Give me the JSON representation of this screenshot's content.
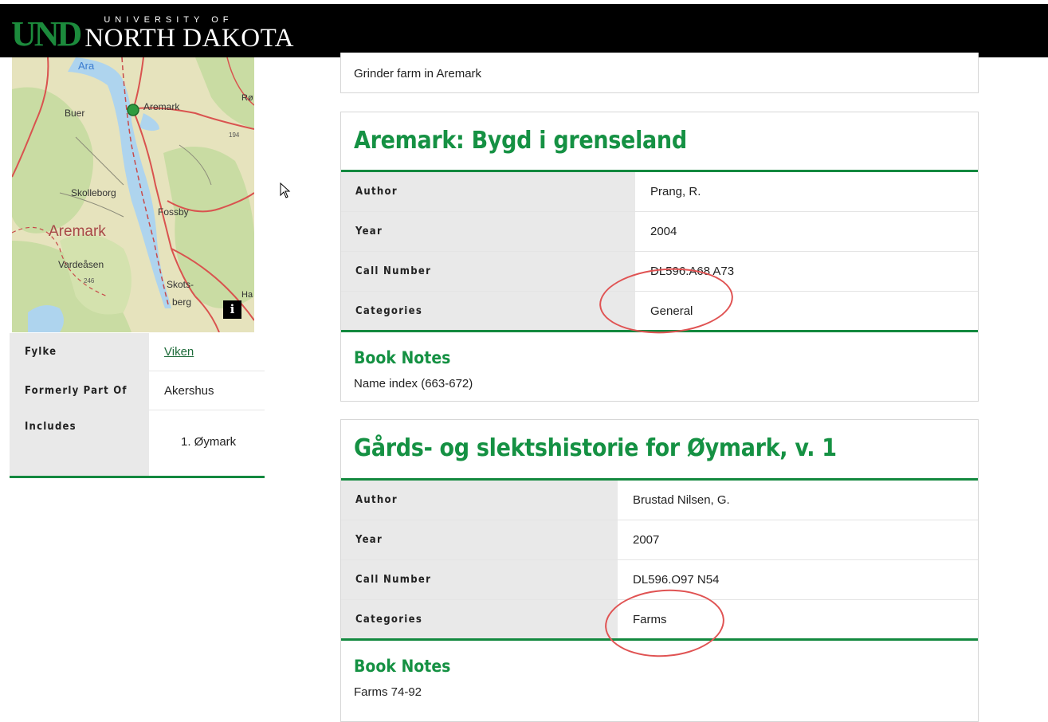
{
  "header": {
    "logo_mark": "UND",
    "university_of": "UNIVERSITY OF",
    "university_name": "NORTH DAKOTA"
  },
  "map": {
    "labels": {
      "ara": "Ara",
      "aremark_village": "Aremark",
      "ro": "Rø",
      "buer": "Buer",
      "n194": "194",
      "skolleborg": "Skolleborg",
      "fossby": "Fossby",
      "aremark_region": "Aremark",
      "vardeasen": "Vardeåsen",
      "n246": "246",
      "skots": "Skots-",
      "berg": "berg",
      "ha": "Ha"
    },
    "info_button": "i",
    "colors": {
      "land": "#e6e3bd",
      "forest": "#c9dca3",
      "water": "#aed4ee",
      "road": "#d9534f",
      "marker": "#2e9b3f"
    }
  },
  "county": {
    "rows": [
      {
        "label": "Fylke",
        "value": "Viken"
      },
      {
        "label": "Formerly Part Of",
        "value": "Akershus"
      },
      {
        "label": "Includes",
        "value": "1. Øymark"
      }
    ]
  },
  "top_card": {
    "text": "Grinder farm in Aremark"
  },
  "books": [
    {
      "title": "Aremark: Bygd i grenseland",
      "fields": [
        {
          "label": "Author",
          "value": "Prang, R."
        },
        {
          "label": "Year",
          "value": "2004"
        },
        {
          "label": "Call Number",
          "value": "DL596.A68 A73"
        },
        {
          "label": "Categories",
          "value": "General"
        }
      ],
      "notes_heading": "Book Notes",
      "notes": "Name index (663-672)"
    },
    {
      "title": "Gårds- og slektshistorie for Øymark, v. 1",
      "fields": [
        {
          "label": "Author",
          "value": "Brustad Nilsen, G."
        },
        {
          "label": "Year",
          "value": "2007"
        },
        {
          "label": "Call Number",
          "value": "DL596.O97 N54"
        },
        {
          "label": "Categories",
          "value": "Farms"
        }
      ],
      "notes_heading": "Book Notes",
      "notes": "Farms 74-92"
    }
  ],
  "colors": {
    "brand_green": "#159143",
    "accent_line": "#13893f",
    "annotation_red": "#e05353",
    "header_bg": "#000000"
  }
}
